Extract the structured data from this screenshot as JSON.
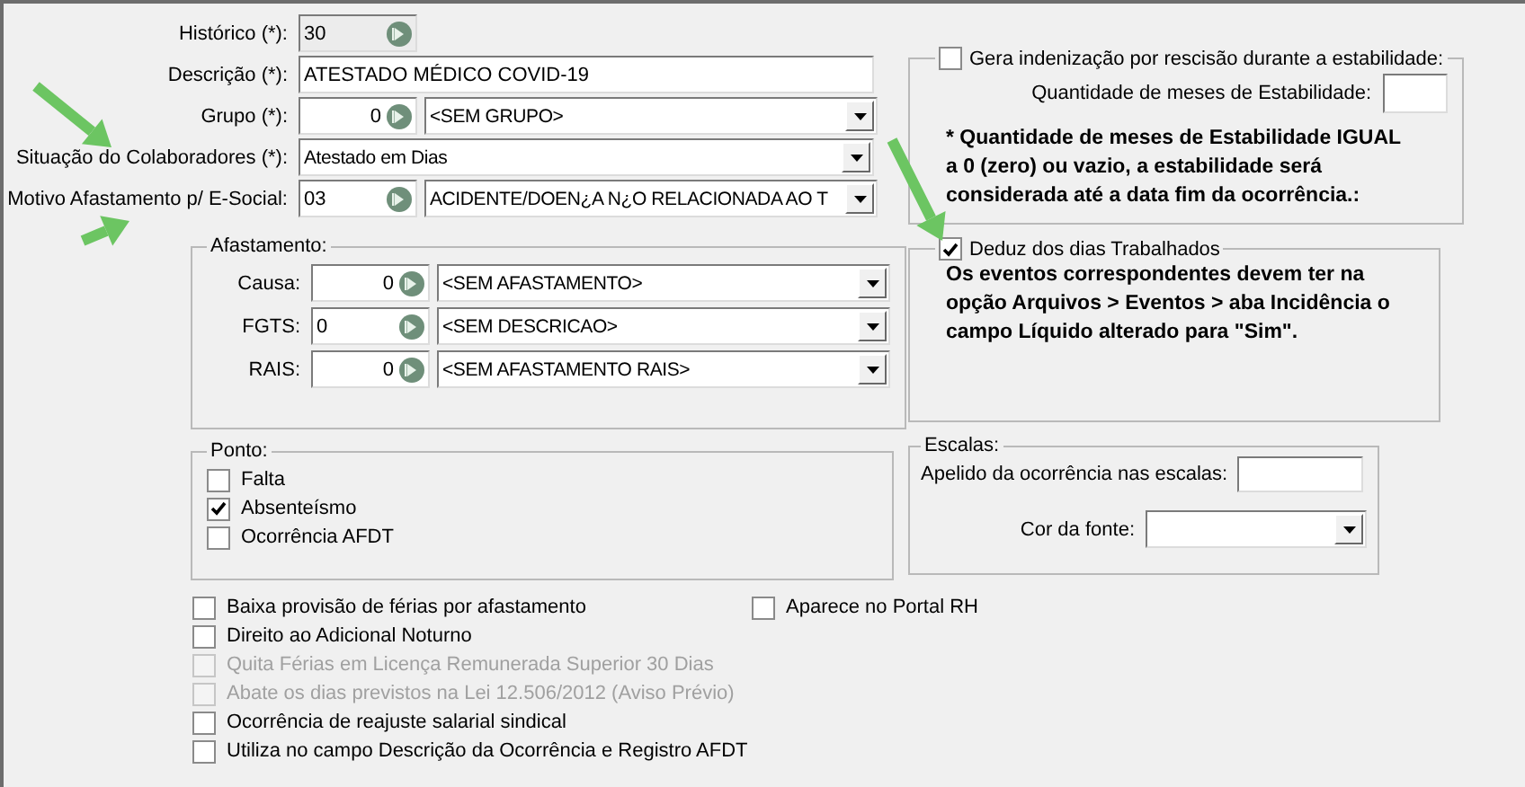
{
  "fields": [
    {
      "kind": "code",
      "label": "Histórico (*):",
      "value": "30",
      "readonly": true
    },
    {
      "kind": "text",
      "label": "Descrição (*):",
      "value": "ATESTADO MÉDICO COVID-19"
    },
    {
      "kind": "number_combo",
      "label": "Grupo (*):",
      "value": "0",
      "option": "<SEM GRUPO>"
    },
    {
      "kind": "combo",
      "label": "Situação do Colaboradores (*):",
      "option": "Atestado em Dias"
    },
    {
      "kind": "code_combo",
      "label": "Motivo Afastamento p/ E-Social:",
      "value": "03",
      "option": "ACIDENTE/DOEN¿A N¿O RELACIONADA AO T"
    }
  ],
  "afastamento": {
    "title": "Afastamento:",
    "fields": [
      {
        "kind": "number_combo",
        "label": "Causa:",
        "value": "0",
        "option": "<SEM AFASTAMENTO>"
      },
      {
        "kind": "code_combo",
        "label": "FGTS:",
        "value": "0",
        "option": "<SEM DESCRICAO>"
      },
      {
        "kind": "number_combo",
        "label": "RAIS:",
        "value": "0",
        "option": "<SEM AFASTAMENTO RAIS>"
      }
    ]
  },
  "ponto": {
    "title": "Ponto:",
    "options": [
      {
        "label": "Falta",
        "checked": false
      },
      {
        "label": "Absenteísmo",
        "checked": true
      },
      {
        "label": "Ocorrência AFDT",
        "checked": false
      }
    ]
  },
  "indenizacao": {
    "label": "Gera indenização por rescisão durante a estabilidade:",
    "checked": false,
    "months_label": "Quantidade de meses de Estabilidade:",
    "note": "* Quantidade de meses de Estabilidade IGUAL a 0 (zero) ou vazio, a estabilidade será considerada até a data fim da ocorrência.:"
  },
  "deduz": {
    "label": "Deduz dos dias Trabalhados",
    "checked": true,
    "note": "Os eventos correspondentes devem ter na opção Arquivos > Eventos > aba Incidência o campo Líquido alterado para \"Sim\"."
  },
  "escalas": {
    "title": "Escalas:",
    "nickname_label": "Apelido da ocorrência nas escalas:",
    "font_color_label": "Cor da fonte:"
  },
  "options": [
    {
      "label": "Baixa provisão de férias por afastamento",
      "checked": false,
      "disabled": false
    },
    {
      "label": "Direito ao Adicional Noturno",
      "checked": false,
      "disabled": false
    },
    {
      "label": "Quita Férias em Licença Remunerada Superior 30 Dias",
      "checked": false,
      "disabled": true
    },
    {
      "label": "Abate os dias previstos na Lei 12.506/2012 (Aviso Prévio)",
      "checked": false,
      "disabled": true
    },
    {
      "label": "Ocorrência de reajuste salarial sindical",
      "checked": false,
      "disabled": false
    },
    {
      "label": "Utiliza no campo Descrição da Ocorrência e Registro AFDT",
      "checked": false,
      "disabled": false
    }
  ],
  "portal": {
    "label": "Aparece no Portal RH",
    "checked": false,
    "disabled": false
  }
}
